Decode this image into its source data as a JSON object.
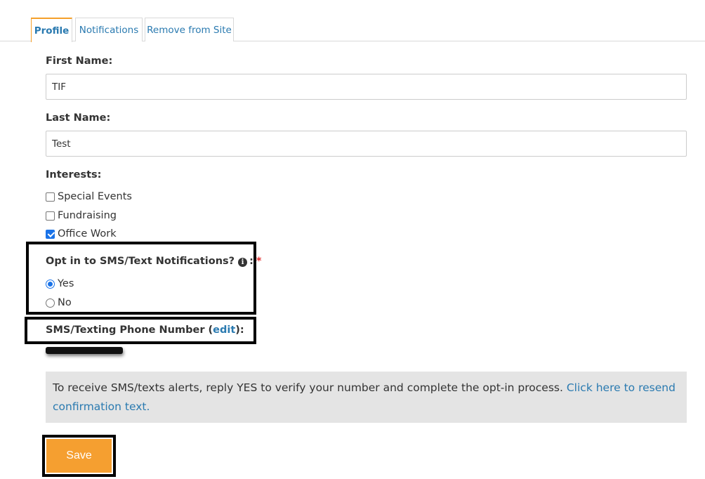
{
  "tabs": [
    {
      "label": "Profile",
      "active": true
    },
    {
      "label": "Notifications",
      "active": false
    },
    {
      "label": "Remove from Site",
      "active": false
    }
  ],
  "form": {
    "first_name_label": "First Name:",
    "first_name_value": "TIF",
    "last_name_label": "Last Name:",
    "last_name_value": "Test",
    "interests_label": "Interests:",
    "interests": [
      {
        "label": "Special Events",
        "checked": false
      },
      {
        "label": "Fundraising",
        "checked": false
      },
      {
        "label": "Office Work",
        "checked": true
      }
    ],
    "sms_optin_label": "Opt in to SMS/Text Notifications?",
    "sms_optin_suffix": ":",
    "required_mark": "*",
    "sms_optin_options": [
      {
        "label": "Yes",
        "selected": true
      },
      {
        "label": "No",
        "selected": false
      }
    ],
    "phone_label_prefix": "SMS/Texting Phone Number (",
    "phone_edit_link": "edit",
    "phone_label_suffix": "):"
  },
  "notice": {
    "text": "To receive SMS/texts alerts, reply YES to verify your number and complete the opt-in process.",
    "link": "Click here to resend confirmation text."
  },
  "save_label": "Save",
  "colors": {
    "accent": "#f59f30",
    "link": "#2a7ab0",
    "notice_bg": "#e4e4e4"
  }
}
